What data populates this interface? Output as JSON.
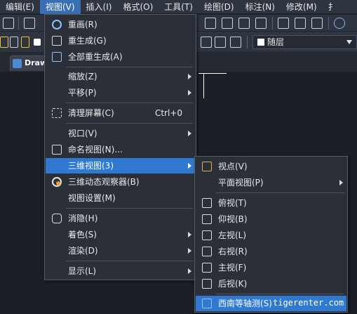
{
  "menubar": {
    "items": [
      "编辑(E)",
      "视图(V)",
      "插入(I)",
      "格式(O)",
      "工具(T)",
      "绘图(D)",
      "标注(N)",
      "修改(M)",
      "扌"
    ],
    "active_index": 1
  },
  "toolbar": {
    "layer_value": "随层"
  },
  "tab": {
    "label": "Draw"
  },
  "view_menu": {
    "items": [
      {
        "label": "重画(R)",
        "icon": "redraw-icon",
        "shortcut": "",
        "submenu": false
      },
      {
        "label": "重生成(G)",
        "icon": "regen-icon",
        "shortcut": "",
        "submenu": false
      },
      {
        "label": "全部重生成(A)",
        "icon": "regen-all-icon",
        "shortcut": "",
        "submenu": false
      },
      {
        "label": "缩放(Z)",
        "icon": "",
        "shortcut": "",
        "submenu": true
      },
      {
        "label": "平移(P)",
        "icon": "",
        "shortcut": "",
        "submenu": true
      },
      {
        "label": "清理屏幕(C)",
        "icon": "clean-screen-icon",
        "shortcut": "Ctrl+0",
        "submenu": false
      },
      {
        "label": "视口(V)",
        "icon": "",
        "shortcut": "",
        "submenu": true
      },
      {
        "label": "命名视图(N)...",
        "icon": "named-view-icon",
        "shortcut": "",
        "submenu": false
      },
      {
        "label": "三维视图(3)",
        "icon": "",
        "shortcut": "",
        "submenu": true
      },
      {
        "label": "三维动态观察器(B)",
        "icon": "3d-orbit-icon",
        "shortcut": "",
        "submenu": false
      },
      {
        "label": "视图设置(M)",
        "icon": "",
        "shortcut": "",
        "submenu": false
      },
      {
        "label": "消隐(H)",
        "icon": "hide-icon",
        "shortcut": "",
        "submenu": false
      },
      {
        "label": "着色(S)",
        "icon": "",
        "shortcut": "",
        "submenu": true
      },
      {
        "label": "渲染(D)",
        "icon": "",
        "shortcut": "",
        "submenu": true
      },
      {
        "label": "显示(L)",
        "icon": "",
        "shortcut": "",
        "submenu": true
      }
    ]
  },
  "view3d_submenu": {
    "items": [
      {
        "label": "视点(V)",
        "icon": "viewpoint-icon",
        "submenu": false
      },
      {
        "label": "平面视图(P)",
        "icon": "",
        "submenu": true
      },
      {
        "label": "俯视(T)",
        "icon": "top-view-icon",
        "submenu": false
      },
      {
        "label": "仰视(B)",
        "icon": "bottom-view-icon",
        "submenu": false
      },
      {
        "label": "左视(L)",
        "icon": "left-view-icon",
        "submenu": false
      },
      {
        "label": "右视(R)",
        "icon": "right-view-icon",
        "submenu": false
      },
      {
        "label": "主视(F)",
        "icon": "front-view-icon",
        "submenu": false
      },
      {
        "label": "后视(K)",
        "icon": "back-view-icon",
        "submenu": false
      },
      {
        "label": "西南等轴测(S)",
        "icon": "sw-isometric-icon",
        "submenu": false
      }
    ]
  },
  "watermark": "tigerenter.com",
  "colors": {
    "menu_bg": "#2b2f38",
    "highlight": "#2f7ad0",
    "app_bg": "#1b1f26"
  }
}
